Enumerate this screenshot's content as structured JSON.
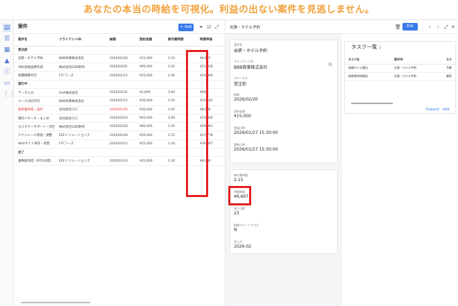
{
  "banner": "あなたの本当の時給を可視化。利益の出ない案件を見逃しません。",
  "list": {
    "title": "案件",
    "add_label": "+ Add",
    "columns": [
      "案件名",
      "クライアントID",
      "納期",
      "契約金額",
      "稼作業時間",
      "時間単価"
    ],
    "groups": [
      {
        "label": "受注前",
        "rows": [
          {
            "name": "出張・ホテル予約",
            "client": "BBB商事株式会社",
            "due": "2026/02/20",
            "amount": "¥15,000",
            "hours": "2:15",
            "rate": "¥6,667",
            "late": false
          },
          {
            "name": "SNS投稿画像作成",
            "client": "株式会社DDD制作",
            "due": "2026/03/01",
            "amount": "¥60,000",
            "hours": "2:45",
            "rate": "¥21,818",
            "late": false
          },
          {
            "name": "経費精算代行",
            "client": "FFFフーズ",
            "due": "2026/02/15",
            "amount": "¥25,000",
            "hours": "2:30",
            "rate": "¥10,000",
            "late": false
          }
        ]
      },
      {
        "label": "進行中",
        "rows": [
          {
            "name": "データ入力",
            "client": "AAA株式会社",
            "due": "2026/01/31",
            "amount": "¥2,000",
            "hours": "3:00",
            "rate": "¥667",
            "late": false
          },
          {
            "name": "メール対応代行",
            "client": "BBB商事株式会社",
            "due": "2026/02/15",
            "amount": "¥30,000",
            "hours": "2:45",
            "rate": "¥10,182",
            "late": false
          },
          {
            "name": "請求書作成・送付",
            "client": "合同会社CCC",
            "due": "2026/01/26",
            "amount": "¥30,000",
            "hours": "2:45",
            "rate": "¥8,000",
            "late": true
          },
          {
            "name": "資料リサーチ・まとめ",
            "client": "合同会社CCC",
            "due": "2026/02/10",
            "amount": "¥45,000",
            "hours": "3:00",
            "rate": "¥15,000",
            "late": false
          },
          {
            "name": "カスタマーサポート一次回答",
            "client": "株式会社DDD制作",
            "due": "2026/02/28",
            "amount": "¥80,000",
            "hours": "2:45",
            "rate": "¥29,091",
            "late": false
          },
          {
            "name": "スケジュール管理・調整",
            "client": "EEEソリューションズ",
            "due": "2026/02/28",
            "amount": "¥50,000",
            "hours": "2:15",
            "rate": "¥17,778",
            "late": false
          },
          {
            "name": "Webサイト保守・更新",
            "client": "FFFフーズ",
            "due": "2026/03/15",
            "amount": "¥55,000",
            "hours": "1:30",
            "rate": "¥36,667",
            "late": false
          }
        ]
      },
      {
        "label": "完了",
        "rows": [
          {
            "name": "議事録作成（MTG同席）",
            "client": "EEEソリューションズ",
            "due": "2026/01/20",
            "amount": "¥20,000",
            "hours": "2:30",
            "rate": "¥8,000",
            "late": false
          }
        ]
      }
    ]
  },
  "detail": {
    "title": "出張・ホテル予約",
    "card1": [
      {
        "label": "案件名",
        "value": "出張・ホテル予約"
      },
      {
        "label": "クライアントID",
        "value": "BBB商事株式会社"
      },
      {
        "label": "ステータス",
        "value": "受注前"
      },
      {
        "label": "納期",
        "value": "2026/02/20"
      },
      {
        "label": "契約金額",
        "value": "¥15,000"
      },
      {
        "label": "登録日時",
        "value": "2026/01/27 15:30:00"
      },
      {
        "label": "更新日時",
        "value": "2026/01/27 15:30:00"
      }
    ],
    "card2": [
      {
        "label": "稼作業時間",
        "value": "2:15"
      },
      {
        "label": "時間単価",
        "value": "¥6,667"
      },
      {
        "label": "残り日数",
        "value": "23"
      },
      {
        "label": "納期アラートフラグ",
        "value": "N"
      },
      {
        "label": "売上月",
        "value": "2026-02"
      }
    ]
  },
  "tasks": {
    "edit_label": "Edit",
    "title": "タスク一覧",
    "count": "2",
    "columns": [
      "タスク名",
      "案件ID",
      "タス"
    ],
    "rows": [
      {
        "name": "候補ホテル選出",
        "project": "出張・ホテル予約",
        "extra": "予算"
      },
      {
        "name": "新幹線時刻確認",
        "project": "出張・ホテル予約",
        "extra": "最寄"
      }
    ],
    "expand_label": "Expand",
    "add_label": "Add"
  },
  "colors": {
    "accent": "#3a79ea",
    "highlight": "#e41f1f",
    "banner": "#f0a23c",
    "overdue": "#d33333"
  }
}
